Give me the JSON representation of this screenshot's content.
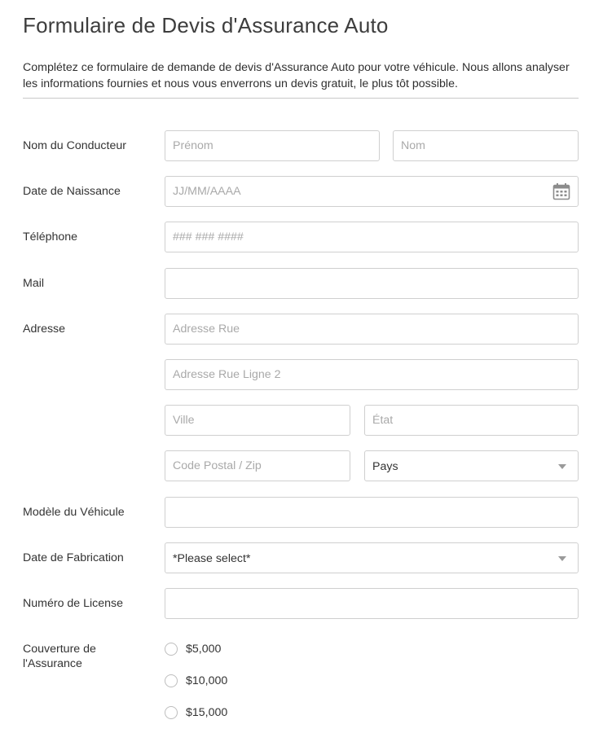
{
  "form": {
    "title": "Formulaire de Devis d'Assurance Auto",
    "description": "Complétez ce formulaire de demande de devis d'Assurance Auto pour votre véhicule.  Nous allons analyser les informations fournies et nous vous enverrons un devis gratuit, le plus tôt possible."
  },
  "fields": {
    "driver_name": {
      "label": "Nom du Conducteur",
      "first_placeholder": "Prénom",
      "last_placeholder": "Nom",
      "first_value": "",
      "last_value": ""
    },
    "birth_date": {
      "label": "Date de Naissance",
      "placeholder": "JJ/MM/AAAA",
      "value": "",
      "icon": "calendar-icon"
    },
    "phone": {
      "label": "Téléphone",
      "placeholder": "### ### ####",
      "value": ""
    },
    "mail": {
      "label": "Mail",
      "placeholder": "",
      "value": ""
    },
    "address": {
      "label": "Adresse",
      "street_placeholder": "Adresse Rue",
      "street2_placeholder": "Adresse Rue Ligne 2",
      "city_placeholder": "Ville",
      "state_placeholder": "État",
      "zip_placeholder": "Code Postal / Zip",
      "country_selected": "Pays"
    },
    "vehicle_model": {
      "label": "Modèle du Véhicule",
      "value": ""
    },
    "manufacture_date": {
      "label": "Date de Fabrication",
      "selected": "*Please select*"
    },
    "license_number": {
      "label": "Numéro de License",
      "value": ""
    },
    "coverage": {
      "label": "Couverture de l'Assurance",
      "options": [
        "$5,000",
        "$10,000",
        "$15,000"
      ]
    }
  },
  "colors": {
    "border": "#cfcfcf",
    "placeholder": "#a9a9a9",
    "text": "#333333",
    "title": "#3d3d3d"
  }
}
